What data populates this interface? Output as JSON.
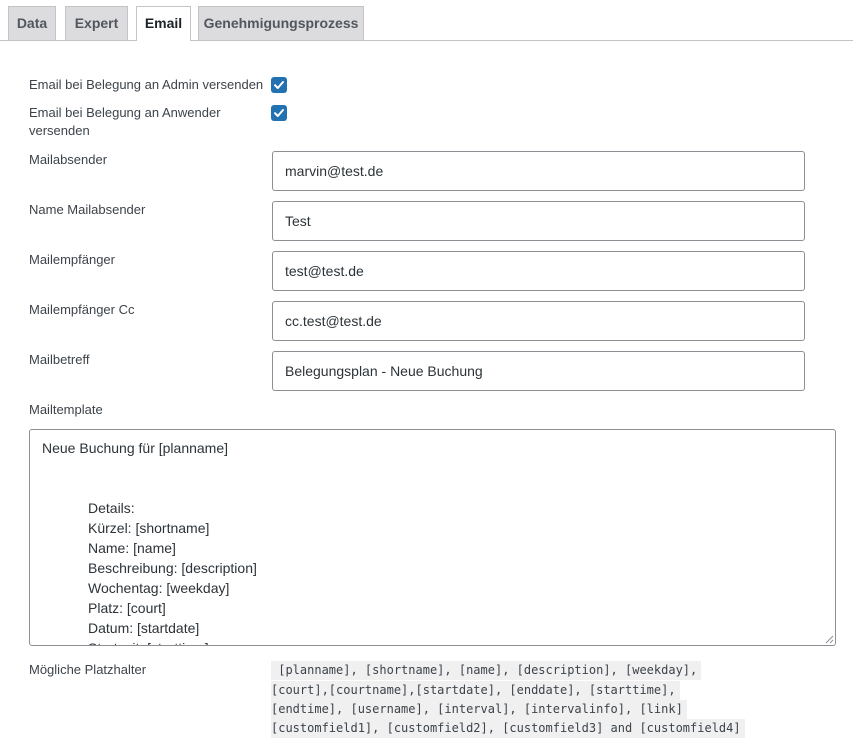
{
  "tabs": [
    {
      "label": "Data",
      "active": false
    },
    {
      "label": "Expert",
      "active": false
    },
    {
      "label": "Email",
      "active": true
    },
    {
      "label": "Genehmigungsprozess",
      "active": false
    }
  ],
  "form": {
    "admin_email": {
      "label": "Email bei Belegung an Admin versenden",
      "checked": true
    },
    "user_email": {
      "label_line1": "Email bei Belegung an Anwender",
      "label_line2": "versenden",
      "checked": true
    },
    "sender": {
      "label": "Mailabsender",
      "value": "marvin@test.de"
    },
    "sender_name": {
      "label": "Name Mailabsender",
      "value": "Test"
    },
    "recipient": {
      "label": "Mailempfänger",
      "value": "test@test.de"
    },
    "recipient_cc": {
      "label": "Mailempfänger Cc",
      "value": "cc.test@test.de"
    },
    "subject": {
      "label": "Mailbetreff",
      "value": "Belegungsplan - Neue Buchung"
    },
    "template": {
      "label": "Mailtemplate",
      "lines": [
        "Neue Buchung für [planname]",
        "Details:",
        "Kürzel: [shortname]",
        "Name: [name]",
        "Beschreibung: [description]",
        "Wochentag: [weekday]",
        "Platz: [court]",
        "Datum: [startdate]",
        "Startzeit: [starttime]"
      ]
    },
    "placeholders": {
      "label": "Mögliche Platzhalter",
      "lines": [
        " [planname], [shortname], [name], [description], [weekday],",
        "[court],[courtname],[startdate], [enddate], [starttime],",
        "[endtime], [username], [interval], [intervalinfo], [link]",
        "[customfield1], [customfield2], [customfield3] and [customfield4]"
      ]
    }
  },
  "colors": {
    "accent": "#2271b1",
    "tab_inactive": "#dcdcde",
    "code_bg": "#f0f0f1"
  }
}
